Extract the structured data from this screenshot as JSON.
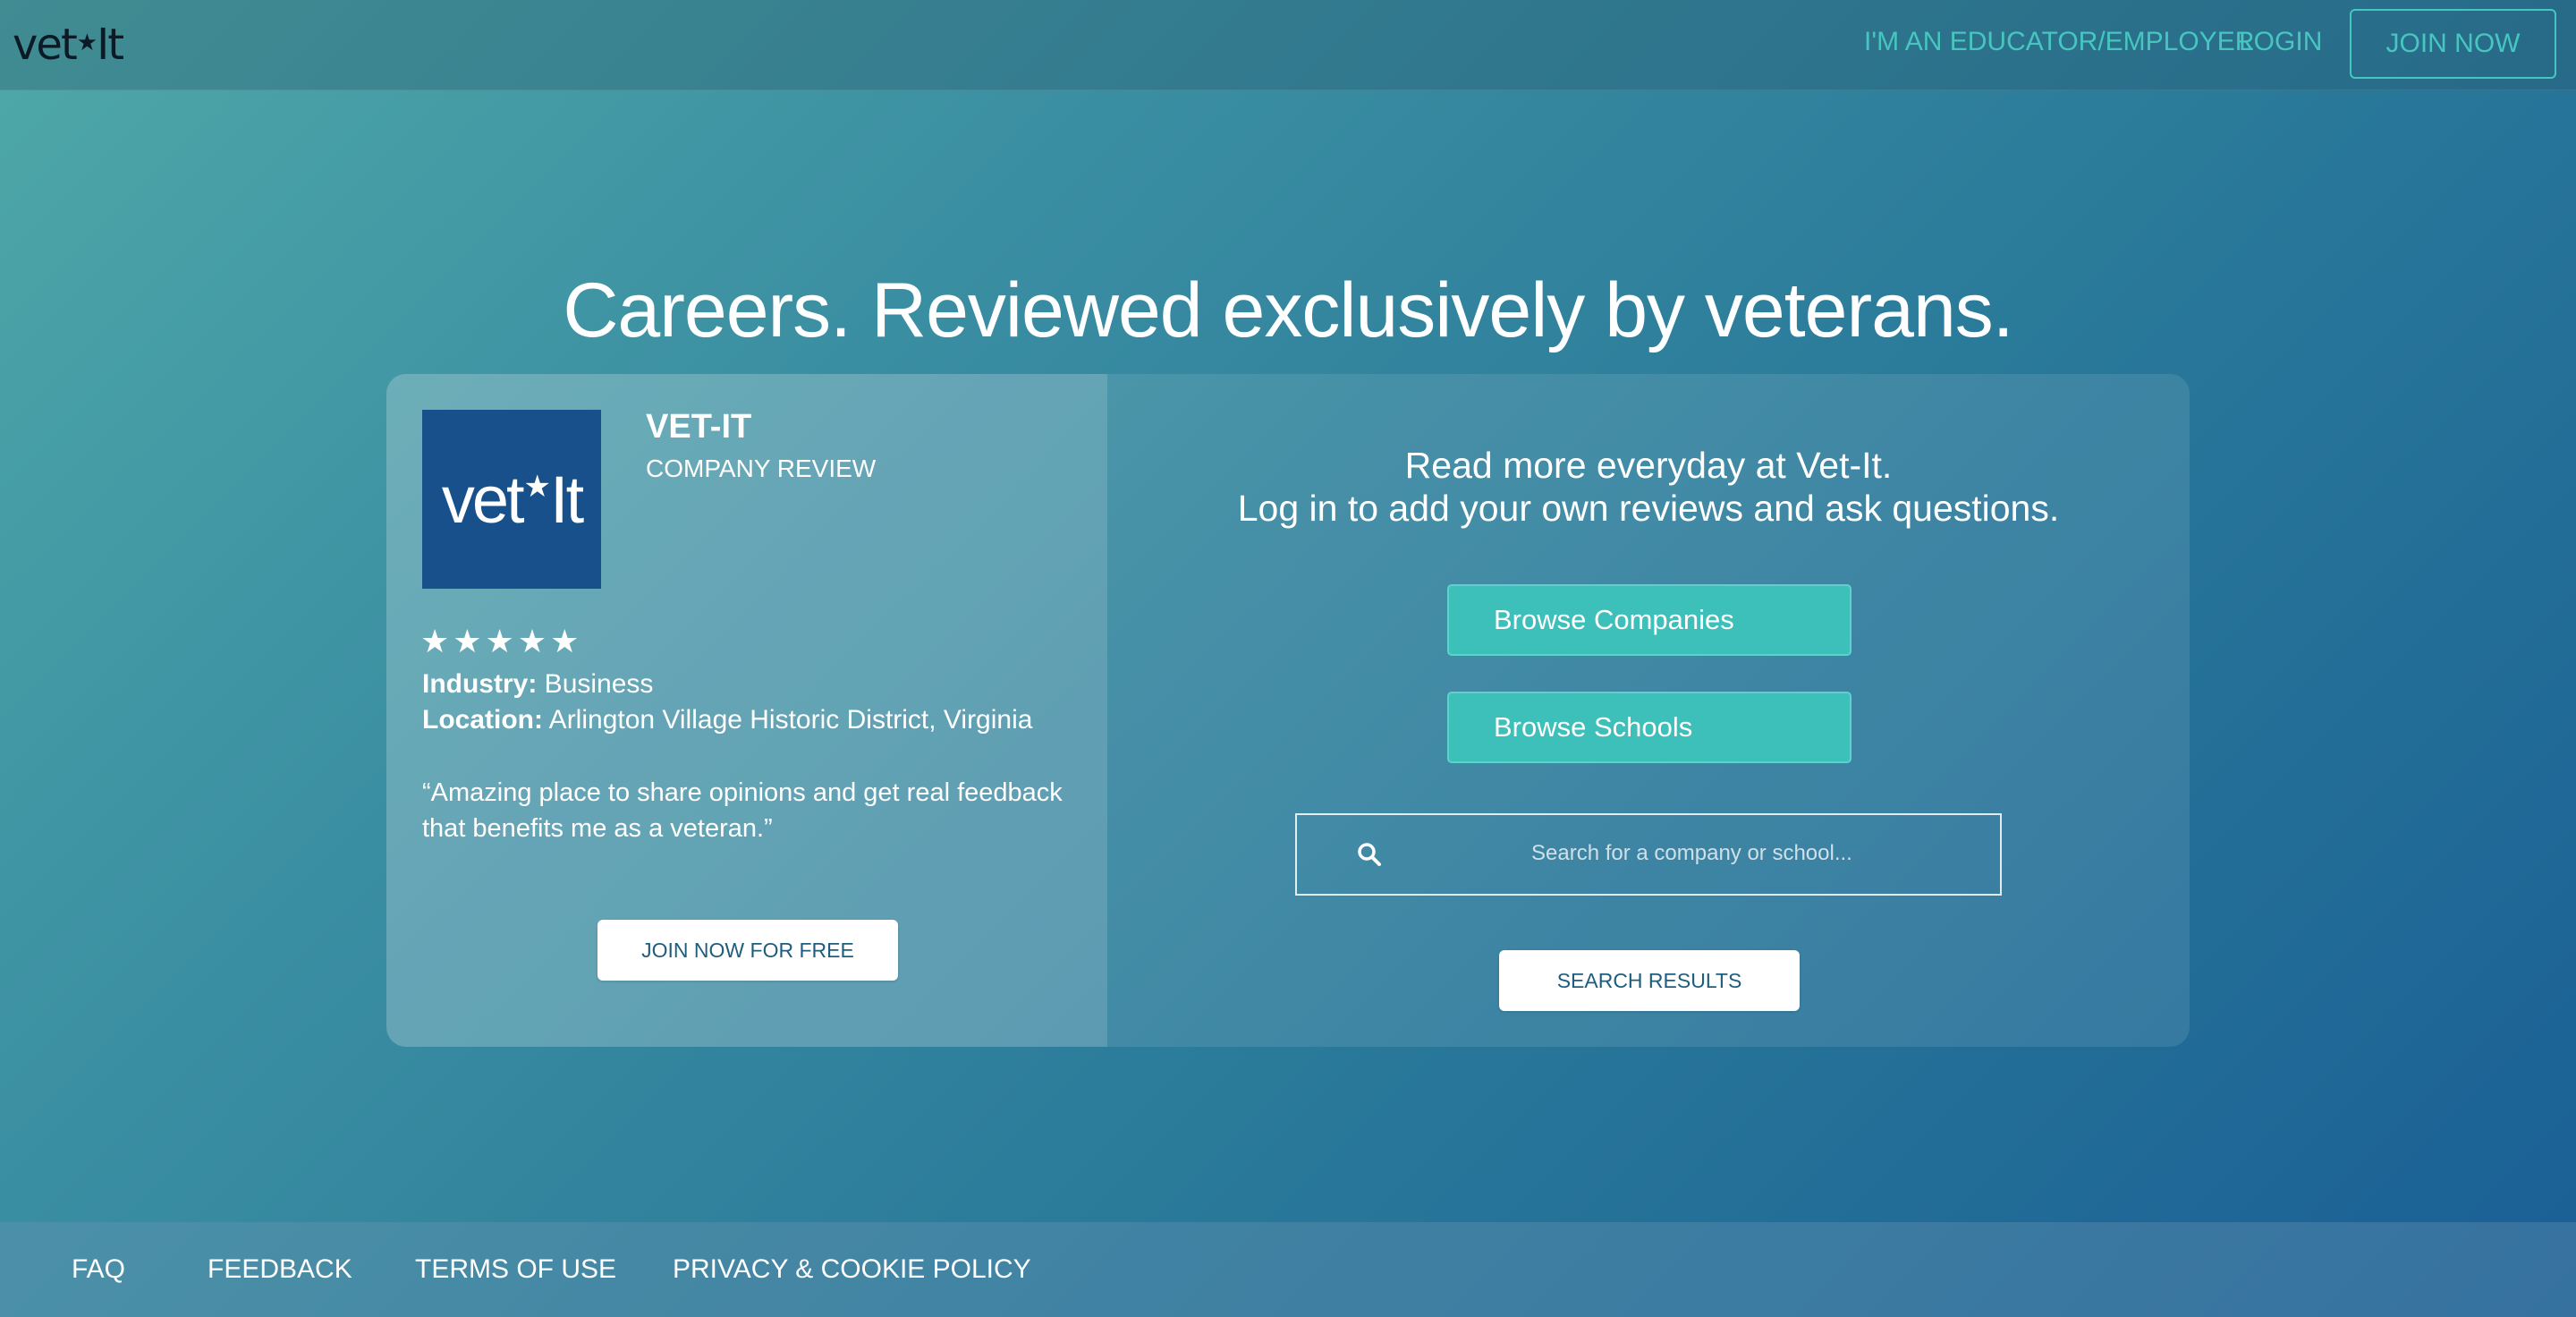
{
  "header": {
    "logo_text_left": "vet",
    "logo_star": "★",
    "logo_text_right": "It",
    "nav": {
      "educator": "I'M AN EDUCATOR/EMPLOYER",
      "login": "LOGIN",
      "join": "JOIN NOW"
    }
  },
  "hero": {
    "title": "Careers. Reviewed exclusively by veterans."
  },
  "review": {
    "logo_text_left": "vet",
    "logo_star": "★",
    "logo_text_right": "It",
    "company_name": "VET-IT",
    "subtitle": "COMPANY REVIEW",
    "rating": 5,
    "stars": "★★★★★",
    "industry_label": "Industry:",
    "industry_value": " Business",
    "location_label": "Location:",
    "location_value": " Arlington Village Historic District, Virginia",
    "quote": "“Amazing place to share opinions and get real feedback that benefits me as a veteran.”",
    "cta": "JOIN NOW FOR FREE"
  },
  "browse": {
    "heading_line1": "Read more everyday at Vet-It.",
    "heading_line2": "Log in to add your own reviews and ask questions.",
    "companies": "Browse Companies",
    "schools": "Browse Schools"
  },
  "search": {
    "icon": "search-icon",
    "placeholder": "Search for a company or school...",
    "button": "SEARCH RESULTS"
  },
  "footer": {
    "links": [
      "FAQ",
      "FEEDBACK",
      "TERMS OF USE",
      "PRIVACY & COOKIE POLICY"
    ]
  },
  "colors": {
    "accent": "#47c6c0",
    "button_teal": "#3dbfba",
    "logo_blue": "#17508a",
    "button_text": "#1f5d7e"
  }
}
